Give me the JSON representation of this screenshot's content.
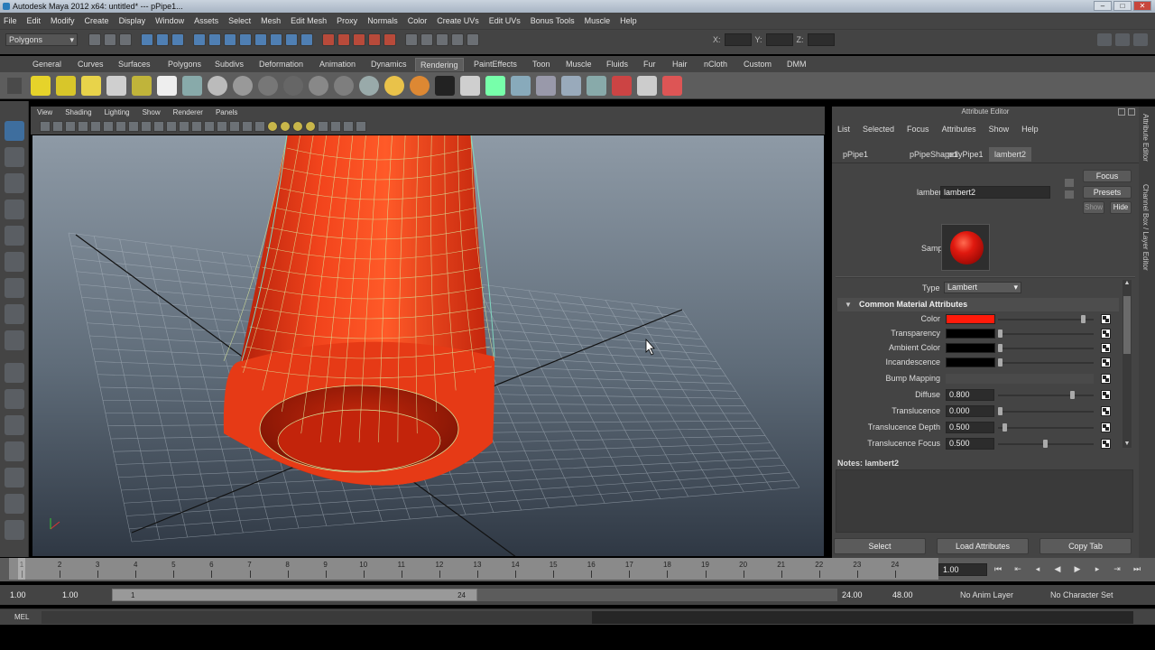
{
  "window": {
    "title": "Autodesk Maya 2012 x64: untitled*   ---   pPipe1..."
  },
  "menubar": [
    "File",
    "Edit",
    "Modify",
    "Create",
    "Display",
    "Window",
    "Assets",
    "Select",
    "Mesh",
    "Edit Mesh",
    "Proxy",
    "Normals",
    "Color",
    "Create UVs",
    "Edit UVs",
    "Bonus Tools",
    "Muscle",
    "Help"
  ],
  "statusline": {
    "mode": "Polygons",
    "x_label": "X:",
    "y_label": "Y:",
    "z_label": "Z:"
  },
  "shelf": {
    "tabs": [
      "General",
      "Curves",
      "Surfaces",
      "Polygons",
      "Subdivs",
      "Deformation",
      "Animation",
      "Dynamics",
      "Rendering",
      "PaintEffects",
      "Toon",
      "Muscle",
      "Fluids",
      "Fur",
      "Hair",
      "nCloth",
      "Custom",
      "DMM"
    ],
    "active_tab": "Rendering"
  },
  "viewport": {
    "menu": [
      "View",
      "Shading",
      "Lighting",
      "Show",
      "Renderer",
      "Panels"
    ],
    "object_color": "#e02a10",
    "wire_color": "#c8e08a"
  },
  "attribute_editor": {
    "title": "Attribute Editor",
    "menu": [
      "List",
      "Selected",
      "Focus",
      "Attributes",
      "Show",
      "Help"
    ],
    "tabs": [
      "pPipe1",
      "pPipeShape1",
      "polyPipe1",
      "lambert2"
    ],
    "active_tab": "lambert2",
    "node_label": "lambert:",
    "node_name": "lambert2",
    "side_buttons": {
      "focus": "Focus",
      "presets": "Presets",
      "show": "Show",
      "hide": "Hide"
    },
    "sample_label": "Sample",
    "type_label": "Type",
    "type_value": "Lambert",
    "section_title": "Common Material Attributes",
    "attributes": [
      {
        "label": "Color",
        "kind": "color",
        "color": "#ff1a0a",
        "slider": 0.92
      },
      {
        "label": "Transparency",
        "kind": "color",
        "color": "#000000",
        "slider": 0.0
      },
      {
        "label": "Ambient Color",
        "kind": "color",
        "color": "#000000",
        "slider": 0.0
      },
      {
        "label": "Incandescence",
        "kind": "color",
        "color": "#000000",
        "slider": 0.0
      },
      {
        "label": "Bump Mapping",
        "kind": "bump"
      },
      {
        "label": "Diffuse",
        "kind": "number",
        "value": "0.800",
        "slider": 0.8
      },
      {
        "label": "Translucence",
        "kind": "number",
        "value": "0.000",
        "slider": 0.0
      },
      {
        "label": "Translucence Depth",
        "kind": "number",
        "value": "0.500",
        "slider": 0.05
      },
      {
        "label": "Translucence Focus",
        "kind": "number",
        "value": "0.500",
        "slider": 0.5
      }
    ],
    "notes_label": "Notes:  lambert2",
    "buttons": {
      "select": "Select",
      "load": "Load Attributes",
      "copy": "Copy Tab"
    }
  },
  "sidetabs": {
    "attribute_editor": "Attribute Editor",
    "channel_box": "Channel Box / Layer Editor"
  },
  "timeslider": {
    "ticks": [
      "1",
      "2",
      "3",
      "4",
      "5",
      "6",
      "7",
      "8",
      "9",
      "10",
      "11",
      "12",
      "13",
      "14",
      "15",
      "16",
      "17",
      "18",
      "19",
      "20",
      "21",
      "22",
      "23",
      "24"
    ],
    "current_frame": "1.00"
  },
  "rangeslider": {
    "start": "1.00",
    "playback_start": "1.00",
    "range_start": "1",
    "range_end": "24",
    "playback_end": "24.00",
    "end": "48.00",
    "anim_layer": "No Anim Layer",
    "character_set": "No Character Set"
  },
  "cmdline": {
    "label": "MEL"
  }
}
